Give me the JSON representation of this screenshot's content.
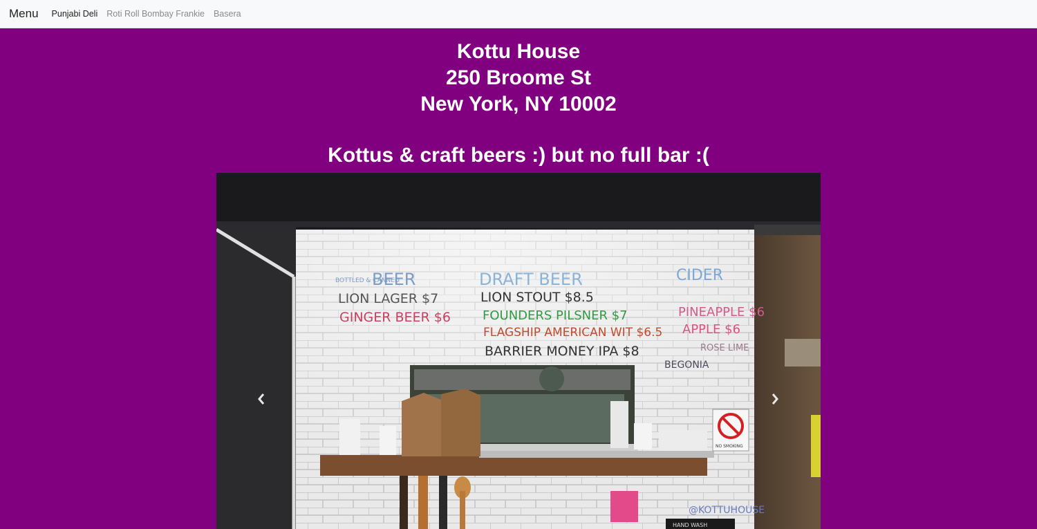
{
  "navbar": {
    "brand": "Menu",
    "links": [
      {
        "label": "Punjabi Deli",
        "active": true
      },
      {
        "label": "Roti Roll Bombay Frankie",
        "active": false
      },
      {
        "label": "Basera",
        "active": false
      }
    ]
  },
  "restaurant": {
    "name": "Kottu House",
    "street": "250 Broome St",
    "city": "New York, NY 10002",
    "tagline": "Kottus & craft beers :) but no full bar :("
  },
  "colors": {
    "background": "#800080",
    "navbar_bg": "#f8f9fa"
  },
  "carousel": {
    "prev_icon": "chevron-left-icon",
    "next_icon": "chevron-right-icon",
    "board": {
      "bottled": "BOTTLED & CANNED",
      "beer": "BEER",
      "draft": "DRAFT BEER",
      "cider": "CIDER",
      "row1_left": "LION LAGER $7",
      "row2_left": "GINGER BEER $6",
      "row1_mid": "LION STOUT $8.5",
      "row2_mid": "FOUNDERS PILSNER $7",
      "row3_mid": "FLAGSHIP AMERICAN WIT $6.5",
      "row4_mid": "BARRIER MONEY IPA $8",
      "row1_right": "PINEAPPLE $6",
      "row2_right": "APPLE $6",
      "row3_right": "ROSE LIME",
      "row4_right": "BEGONIA",
      "handle": "@KOTTUHOUSE",
      "nosmoking": "NO SMOKING",
      "handwash": "HAND WASH"
    }
  }
}
